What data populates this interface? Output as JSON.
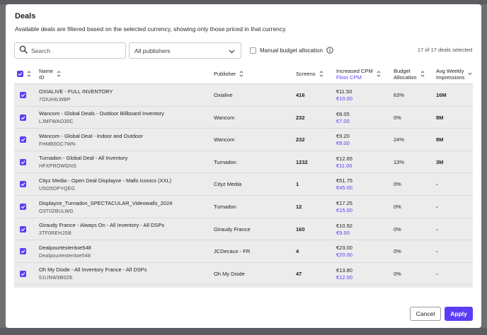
{
  "dialog": {
    "title": "Deals",
    "subtitle": "Available deals are filtered based on the selected currency, showing only those priced in that currency."
  },
  "filters": {
    "search_placeholder": "Search",
    "publisher_select_value": "All publishers",
    "manual_budget_label": "Manual budget allocation",
    "manual_budget_checked": false,
    "selected_count": "17 of 17 deals selected"
  },
  "table": {
    "headers": {
      "name": "Name",
      "id": "ID",
      "publisher": "Publisher",
      "screens": "Screens",
      "cpm": "Increased CPM",
      "floor": "Floor CPM",
      "budget_1": "Budget",
      "budget_2": "Allocation",
      "impressions_1": "Avg Weekly",
      "impressions_2": "Impressions"
    },
    "rows": [
      {
        "name": "OXIALIVE - FULL INVENTORY",
        "id": "7OIUHILWBP",
        "publisher": "Oxialive",
        "screens": "416",
        "cpm": "€11.50",
        "floor": "€10.00",
        "budget": "63%",
        "impressions": "16M"
      },
      {
        "name": "Wancom - Global Deals - Outdoor Billboard Inventory",
        "id": "LJMFWAO30C",
        "publisher": "Wancom",
        "screens": "232",
        "cpm": "€8.05",
        "floor": "€7.00",
        "budget": "0%",
        "impressions": "8M"
      },
      {
        "name": "Wancom - Global Deal - Indoor and Outdoor",
        "id": "FHMB0DC7WN",
        "publisher": "Wancom",
        "screens": "232",
        "cpm": "€9.20",
        "floor": "€8.00",
        "budget": "24%",
        "impressions": "8M"
      },
      {
        "name": "Turnadon - Global Deal - All Inventory",
        "id": "HFXPROWGNS",
        "publisher": "Turnadon",
        "screens": "1232",
        "cpm": "€12.65",
        "floor": "€11.00",
        "budget": "13%",
        "impressions": "3M"
      },
      {
        "name": "Cityz Media - Open Deal Displayce - Malls Iconics (XXL)",
        "id": "USO5DPYQEG",
        "publisher": "Cityz Media",
        "screens": "1",
        "cpm": "€51.75",
        "floor": "€45.00",
        "budget": "0%",
        "impressions": "-"
      },
      {
        "name": "Displayce_Turnadon_SPECTACULAR_Videowalls_2024",
        "id": "O3T0ZBULWG",
        "publisher": "Turnadon",
        "screens": "12",
        "cpm": "€17.25",
        "floor": "€15.00",
        "budget": "0%",
        "impressions": "-"
      },
      {
        "name": "Giraudy France - Always On - All Inventory - All DSPs",
        "id": "3TF0REHJSB",
        "publisher": "Giraudy France",
        "screens": "160",
        "cpm": "€10.92",
        "floor": "€9.50",
        "budget": "0%",
        "impressions": "-"
      },
      {
        "name": "Dealpourtesteritoe548",
        "id": "Dealpourtesteritoe548",
        "publisher": "JCDecaux - FR",
        "screens": "4",
        "cpm": "€23.00",
        "floor": "€20.00",
        "budget": "0%",
        "impressions": "-"
      },
      {
        "name": "Oh My Diode - All Inventory France - All DSPs",
        "id": "51UNW3B0ZE",
        "publisher": "Oh My Diode",
        "screens": "47",
        "cpm": "€13.80",
        "floor": "€12.00",
        "budget": "0%",
        "impressions": "-"
      }
    ]
  },
  "buttons": {
    "cancel": "Cancel",
    "apply": "Apply"
  },
  "icons": {
    "search": "search-icon",
    "chevron": "chevron-down-icon",
    "info": "info-icon",
    "sort": "sort-icon",
    "check": "check-icon"
  },
  "colors": {
    "accent": "#5b3df5"
  }
}
